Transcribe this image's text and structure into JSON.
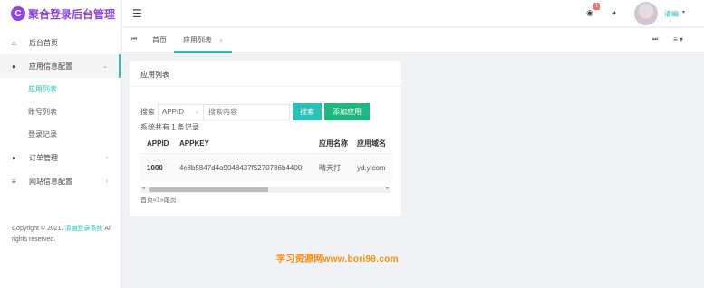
{
  "app": {
    "logo_letter": "C",
    "title": "聚合登录后台管理"
  },
  "sidebar": {
    "items": [
      {
        "label": "后台首页",
        "icon": "home-icon",
        "glyph": "⌂"
      },
      {
        "label": "应用信息配置",
        "icon": "palette-icon",
        "glyph": "●",
        "arrow": "⌄"
      },
      {
        "label": "订单管理",
        "icon": "palette-icon",
        "glyph": "●",
        "arrow": "›"
      },
      {
        "label": "网站信息配置",
        "icon": "list-icon",
        "glyph": "≡",
        "arrow": "›"
      }
    ],
    "sub_items": [
      "应用列表",
      "账号列表",
      "登录记录"
    ],
    "copyright_prefix": "Copyright © 2021. ",
    "copyright_link": "清幽登录系统",
    "copyright_suffix": " All rights reserved."
  },
  "topbar": {
    "menu_glyph": "☰",
    "bell_glyph": "🔔",
    "bell_badge": "1",
    "theme_glyph": "◕",
    "username": "清幽",
    "username_caret": "▾"
  },
  "tabs": {
    "prev_glyph": "⏮",
    "home": "首页",
    "active": "应用列表",
    "close_glyph": "×",
    "next_glyph": "⏭",
    "menu_glyph": "≡ ▾"
  },
  "card": {
    "title": "应用列表",
    "search_label": "搜索",
    "select_value": "APPID",
    "select_caret": "⌄",
    "search_placeholder": "搜索内容",
    "search_button": "搜索",
    "add_button": "添加应用",
    "summary": "系统共有 1 条记录"
  },
  "table": {
    "headers": [
      "APPID",
      "APPKEY",
      "应用名称",
      "应用域名"
    ],
    "rows": [
      [
        "1000",
        "4c8b5847d4a9048437f5270786b4400",
        "晴天打",
        "yd.ylcom"
      ]
    ]
  },
  "scroll": {
    "left_glyph": "◂",
    "right_glyph": "▸"
  },
  "pager": {
    "text": "首页«1»尾页"
  },
  "watermark": {
    "text": "学习资源网www.bori99.com",
    "color": "#ff8c00"
  },
  "colors": {
    "brand": "#8e44ec",
    "accent": "#2bc0b8",
    "add_button": "#1fb77f",
    "badge": "#f56c6c"
  }
}
